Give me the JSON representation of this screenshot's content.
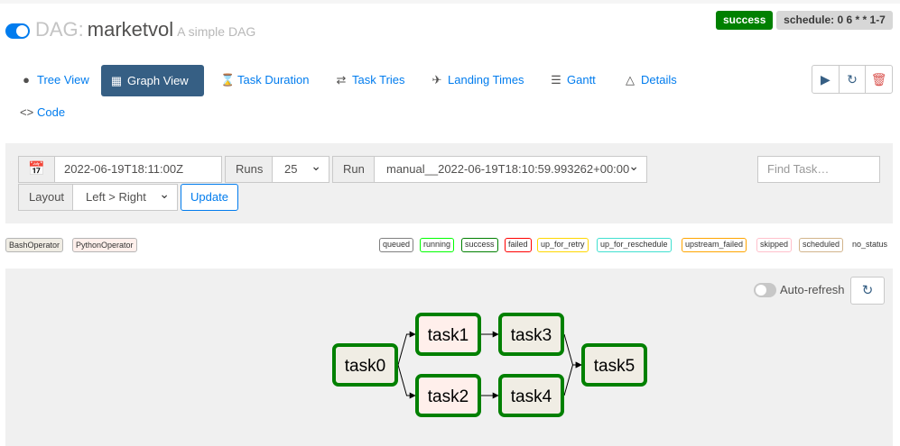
{
  "header": {
    "dag_prefix": "DAG:",
    "dag_id": "marketvol",
    "description": "A simple DAG",
    "status_badge": "success",
    "schedule_badge": "schedule: 0 6 * * 1-7"
  },
  "nav": {
    "tabs": [
      {
        "label": "Tree View",
        "icon": "tree-icon"
      },
      {
        "label": "Graph View",
        "icon": "graph-icon",
        "active": true
      },
      {
        "label": "Task Duration",
        "icon": "hourglass-icon"
      },
      {
        "label": "Task Tries",
        "icon": "retry-icon"
      },
      {
        "label": "Landing Times",
        "icon": "plane-landing-icon"
      },
      {
        "label": "Gantt",
        "icon": "gantt-icon"
      },
      {
        "label": "Details",
        "icon": "warning-icon"
      },
      {
        "label": "Code",
        "icon": "code-icon"
      }
    ],
    "actions": [
      "play-icon",
      "refresh-icon",
      "trash-icon"
    ]
  },
  "form": {
    "base_date": "2022-06-19T18:11:00Z",
    "runs_label": "Runs",
    "runs_value": "25",
    "run_label": "Run",
    "run_value": "manual__2022-06-19T18:10:59.993262+00:00",
    "find_placeholder": "Find Task…",
    "layout_label": "Layout",
    "layout_value": "Left > Right",
    "update_label": "Update"
  },
  "legend": {
    "operators": [
      {
        "label": "BashOperator",
        "color": "#f0ede4"
      },
      {
        "label": "PythonOperator",
        "color": "#ffefeb"
      }
    ],
    "states": [
      {
        "label": "queued",
        "color": "#808080"
      },
      {
        "label": "running",
        "color": "#00ff00"
      },
      {
        "label": "success",
        "color": "#008000"
      },
      {
        "label": "failed",
        "color": "#ff0000"
      },
      {
        "label": "up_for_retry",
        "color": "#ffd700"
      },
      {
        "label": "up_for_reschedule",
        "color": "#40e0d0"
      },
      {
        "label": "upstream_failed",
        "color": "#ffa500"
      },
      {
        "label": "skipped",
        "color": "#ffc0cb"
      },
      {
        "label": "scheduled",
        "color": "#d2b48c"
      },
      {
        "label": "no_status",
        "color": "#ffffff"
      }
    ]
  },
  "graph": {
    "auto_refresh_label": "Auto-refresh",
    "tasks": [
      {
        "id": "task0",
        "operator": "BashOperator",
        "state": "success"
      },
      {
        "id": "task1",
        "operator": "PythonOperator",
        "state": "success"
      },
      {
        "id": "task2",
        "operator": "PythonOperator",
        "state": "success"
      },
      {
        "id": "task3",
        "operator": "BashOperator",
        "state": "success"
      },
      {
        "id": "task4",
        "operator": "BashOperator",
        "state": "success"
      },
      {
        "id": "task5",
        "operator": "BashOperator",
        "state": "success"
      }
    ],
    "edges": [
      [
        "task0",
        "task1"
      ],
      [
        "task0",
        "task2"
      ],
      [
        "task1",
        "task3"
      ],
      [
        "task2",
        "task4"
      ],
      [
        "task3",
        "task5"
      ],
      [
        "task4",
        "task5"
      ]
    ],
    "colors": {
      "success_border": "#008000",
      "bash_fill": "#f0ede4",
      "python_fill": "#ffefeb"
    }
  }
}
